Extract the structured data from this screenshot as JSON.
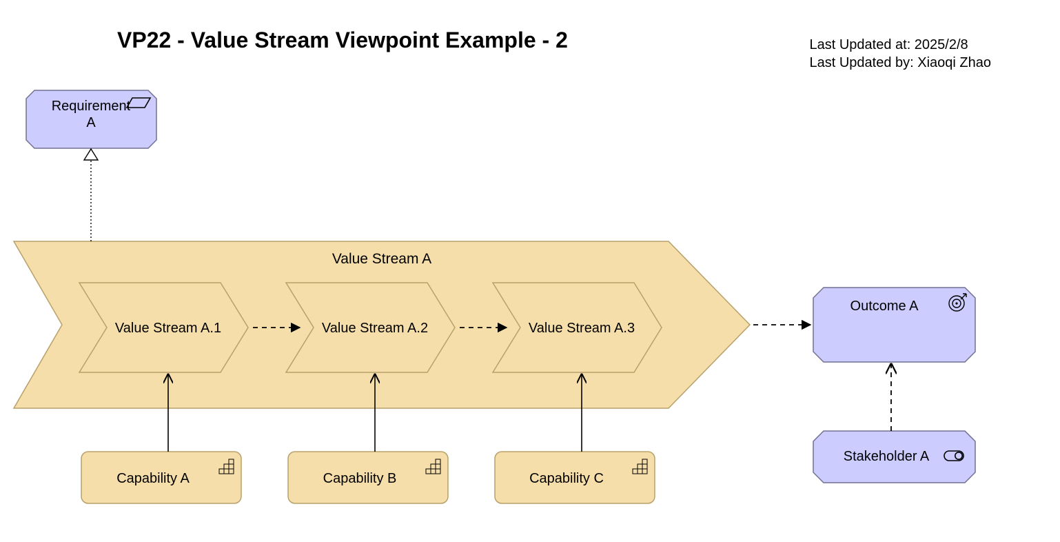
{
  "title": "VP22 - Value Stream Viewpoint Example - 2",
  "meta": {
    "updated_at_label": "Last Updated at: 2025/2/8",
    "updated_by_label": "Last Updated by: Xiaoqi Zhao"
  },
  "elements": {
    "requirement": {
      "label": "Requirement A"
    },
    "value_stream": {
      "label": "Value Stream A",
      "stages": [
        {
          "label": "Value Stream A.1"
        },
        {
          "label": "Value Stream A.2"
        },
        {
          "label": "Value Stream A.3"
        }
      ]
    },
    "capabilities": [
      {
        "label": "Capability A"
      },
      {
        "label": "Capability B"
      },
      {
        "label": "Capability C"
      }
    ],
    "outcome": {
      "label": "Outcome A"
    },
    "stakeholder": {
      "label": "Stakeholder A"
    }
  },
  "colors": {
    "motivation_fill": "#CCCCFF",
    "motivation_stroke": "#707090",
    "strategy_fill": "#F5DEAA",
    "strategy_stroke": "#B8A06A",
    "text": "#000000"
  }
}
